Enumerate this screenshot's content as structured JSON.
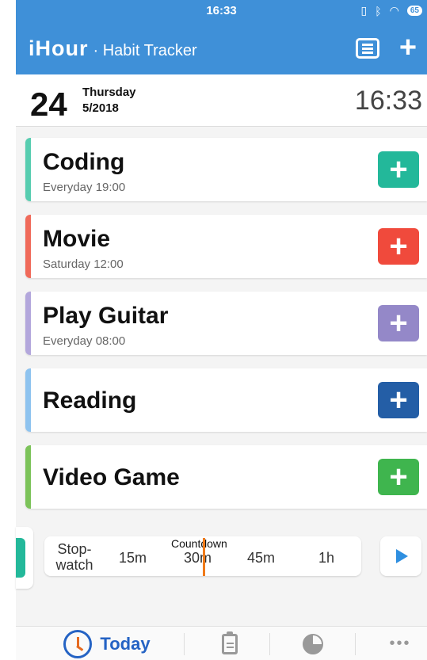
{
  "status_bar": {
    "time": "16:33",
    "battery": "65"
  },
  "header": {
    "logo": "iHour",
    "subtitle": "· Habit Tracker"
  },
  "date": {
    "day": "24",
    "weekday": "Thursday",
    "month_year": "5/2018",
    "clock": "16:33"
  },
  "habits": [
    {
      "name": "Coding",
      "schedule": "Everyday 19:00",
      "color": "#57cdb0",
      "button_color": "#23b89a"
    },
    {
      "name": "Movie",
      "schedule": "Saturday 12:00",
      "color": "#f06a5a",
      "button_color": "#f04a3c"
    },
    {
      "name": "Play Guitar",
      "schedule": "Everyday 08:00",
      "color": "#b3a7dc",
      "button_color": "#9488c8"
    },
    {
      "name": "Reading",
      "schedule": "",
      "color": "#8ec3ef",
      "button_color": "#245ea6"
    },
    {
      "name": "Video Game",
      "schedule": "",
      "color": "#7cc35a",
      "button_color": "#3fb54e"
    }
  ],
  "timer": {
    "stopwatch_line1": "Stop-",
    "stopwatch_line2": "watch",
    "countdown_label": "Countdown",
    "ticks": [
      "15m",
      "30m",
      "45m",
      "1h"
    ]
  },
  "tabbar": {
    "today_label": "Today",
    "more_label": "•••"
  },
  "colors": {
    "primary": "#3f90d8",
    "accent": "#2563c4",
    "needle": "#f07b1a"
  }
}
